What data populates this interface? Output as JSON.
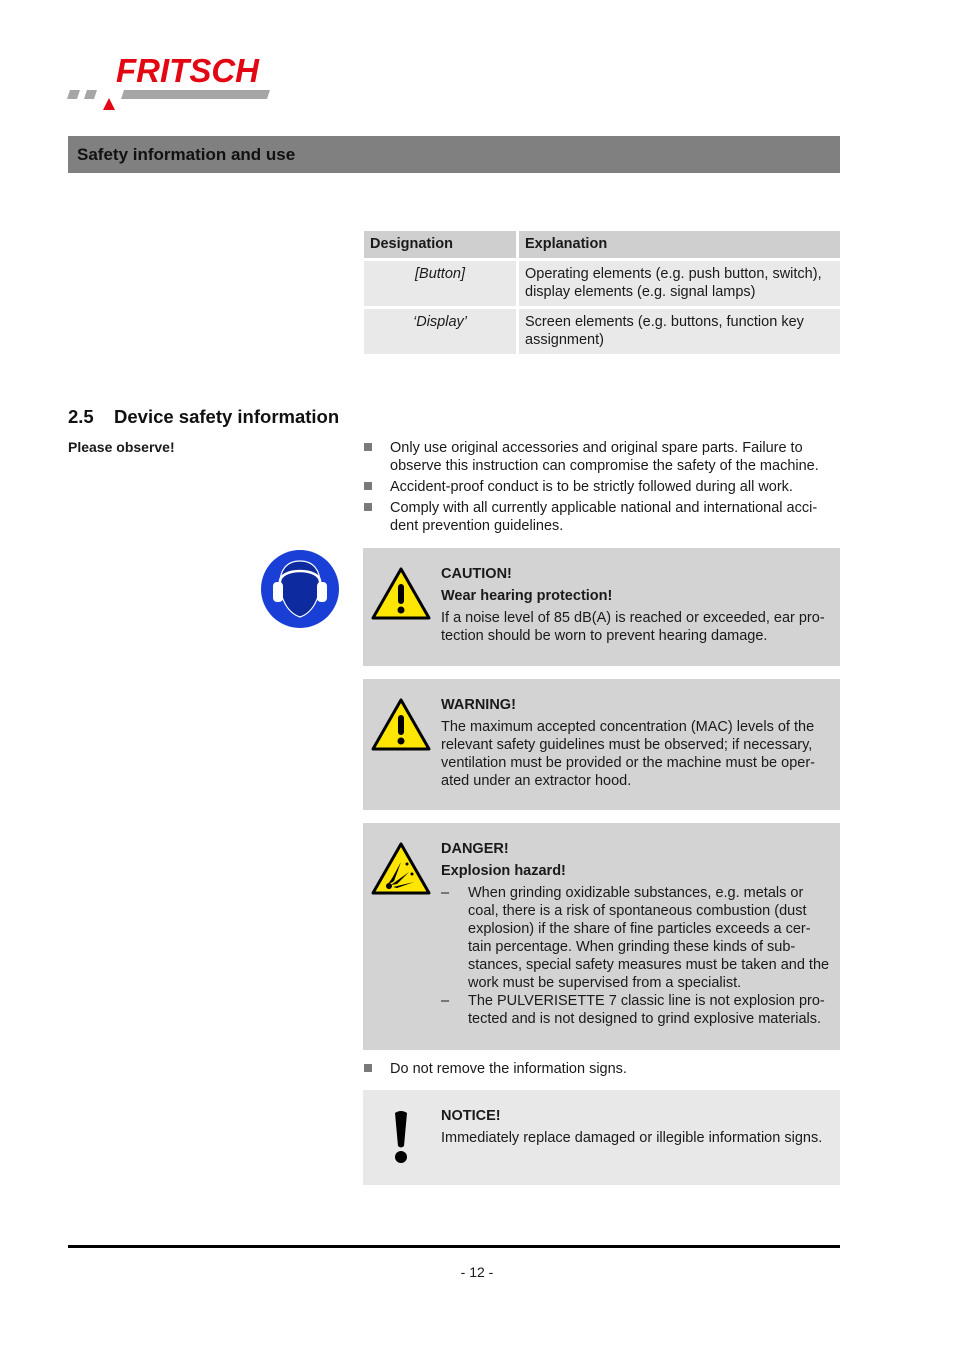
{
  "logo": {
    "text": "FRITSCH",
    "brand_color": "#e30613",
    "bar_color": "#a6a6a6"
  },
  "section_bar": {
    "title": "Safety information and use",
    "color": "#808080"
  },
  "table": {
    "headers": [
      "Designation",
      "Explanation"
    ],
    "rows": [
      {
        "designation": "[Button]",
        "explanation": "Operating elements (e.g. push button, switch), display elements (e.g. signal lamps)"
      },
      {
        "designation": "‘Display’",
        "explanation": "Screen elements (e.g. buttons, function key assignment)"
      }
    ]
  },
  "heading": {
    "number": "2.5",
    "title": "Device safety information"
  },
  "side_label": "Please observe!",
  "bullets_top": [
    "Only use original accessories and original spare parts. Failure to observe this instruction can compromise the safety of the machine.",
    "Accident-proof conduct is to be strictly followed during all work.",
    "Comply with all currently applicable national and international acci-dent prevention guidelines."
  ],
  "caution": {
    "icon": "warning-triangle-icon",
    "signal": "CAUTION!",
    "subtitle": "Wear hearing protection!",
    "text": "If a noise level of 85 dB(A) is reached or exceeded, ear pro-tection should be worn to prevent hearing damage."
  },
  "warning": {
    "icon": "warning-triangle-icon",
    "signal": "WARNING!",
    "text": "The maximum accepted concentration (MAC) levels of the relevant safety guidelines must be observed; if necessary, ventilation must be provided or the machine must be oper-ated under an extractor hood."
  },
  "danger": {
    "icon": "explosion-hazard-icon",
    "signal": "DANGER!",
    "subtitle": "Explosion hazard!",
    "items": [
      "When grinding oxidizable substances, e.g. metals or coal, there is a risk of spontaneous combustion (dust explosion) if the share of fine particles exceeds a cer-tain percentage. When grinding these kinds of sub-stances, special safety measures must be taken and the work must be supervised from a specialist.",
      "The PULVERISETTE 7 classic line is not explosion pro-tected and is not designed to grind explosive materials."
    ],
    "dash": "–"
  },
  "bullets_bottom": [
    "Do not remove the information signs."
  ],
  "notice": {
    "icon": "exclamation-icon",
    "signal": "NOTICE!",
    "text": "Immediately replace damaged or illegible information signs."
  },
  "footer": {
    "page_number": "- 12 -"
  },
  "colors": {
    "hazard_yellow": "#ffe600",
    "mandatory_blue": "#1a3fd6",
    "box_gray": "#d3d3d3",
    "notice_gray": "#e8e8e8"
  }
}
